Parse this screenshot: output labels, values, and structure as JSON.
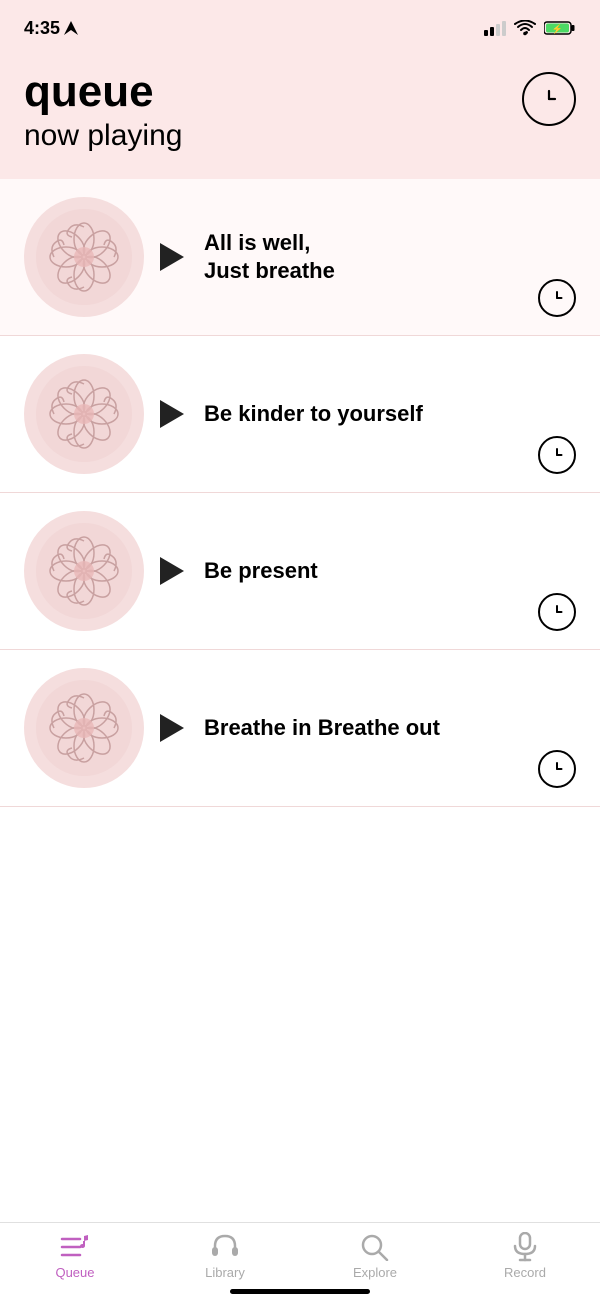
{
  "statusBar": {
    "time": "4:35",
    "batteryLevel": "charging"
  },
  "header": {
    "title": "queue",
    "subtitle": "now playing",
    "clockIconLabel": "history"
  },
  "tracks": [
    {
      "id": 1,
      "title": "All is well,\nJust breathe"
    },
    {
      "id": 2,
      "title": "Be kinder to yourself"
    },
    {
      "id": 3,
      "title": "Be present"
    },
    {
      "id": 4,
      "title": "Breathe in Breathe out"
    }
  ],
  "tabBar": {
    "tabs": [
      {
        "id": "queue",
        "label": "Queue",
        "active": true
      },
      {
        "id": "library",
        "label": "Library",
        "active": false
      },
      {
        "id": "explore",
        "label": "Explore",
        "active": false
      },
      {
        "id": "record",
        "label": "Record",
        "active": false
      }
    ]
  }
}
